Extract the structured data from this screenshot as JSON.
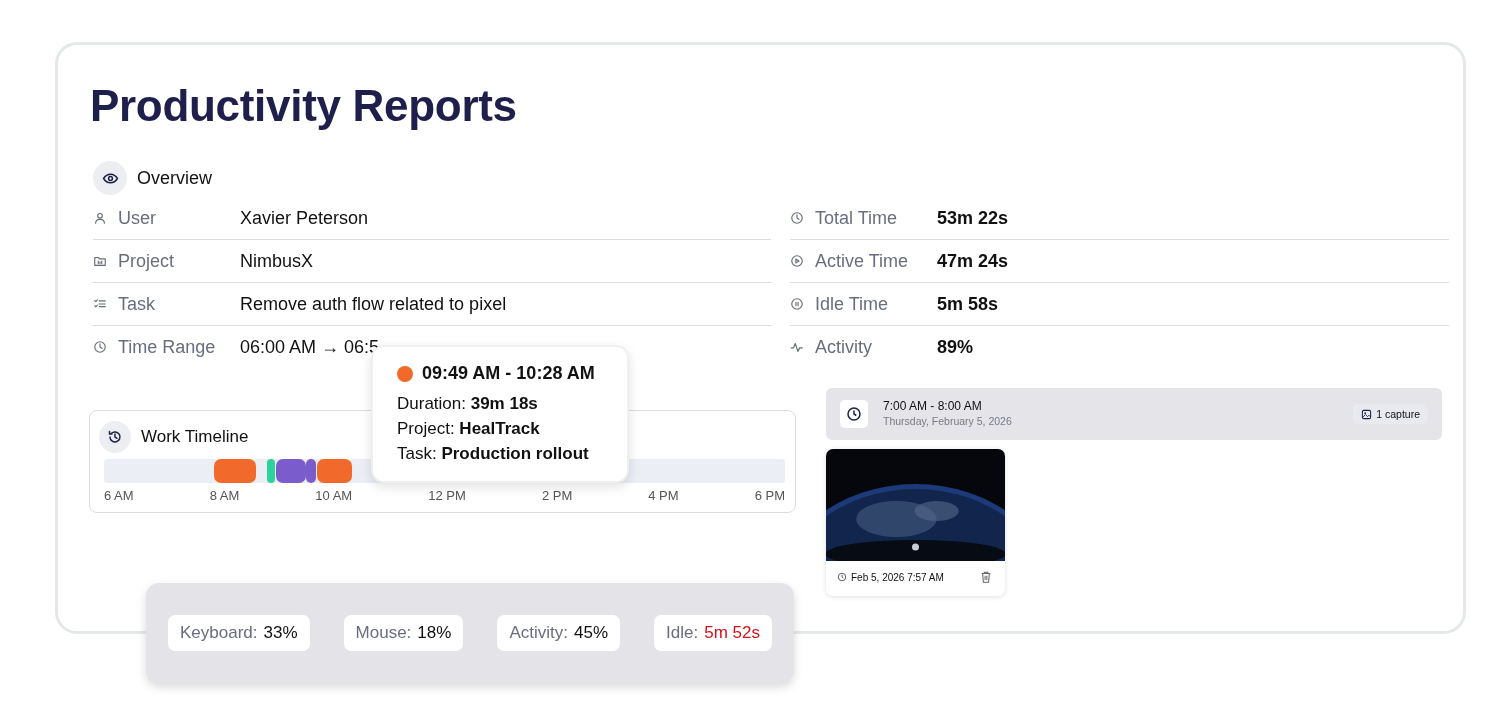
{
  "page": {
    "title": "Productivity Reports"
  },
  "overview": {
    "title": "Overview"
  },
  "details_left": [
    {
      "label": "User",
      "value": "Xavier Peterson"
    },
    {
      "label": "Project",
      "value": "NimbusX"
    },
    {
      "label": "Task",
      "value": "Remove auth flow related to pixel"
    },
    {
      "label": "Time Range",
      "value": "06:00 AM → 06:5"
    }
  ],
  "details_right": [
    {
      "label": "Total Time",
      "value": "53m 22s"
    },
    {
      "label": "Active Time",
      "value": "47m 24s"
    },
    {
      "label": "Idle Time",
      "value": "5m 58s"
    },
    {
      "label": "Activity",
      "value": "89%"
    }
  ],
  "timeline": {
    "title": "Work Timeline",
    "ticks": [
      "6 AM",
      "8 AM",
      "10 AM",
      "12 PM",
      "2 PM",
      "4 PM",
      "6 PM"
    ],
    "segments": [
      {
        "color": "#f26a2b"
      },
      {
        "color": "#2bd49a"
      },
      {
        "color": "#7a5ccc"
      },
      {
        "color": "#7a5ccc"
      },
      {
        "color": "#f26a2b"
      }
    ]
  },
  "tooltip": {
    "color": "#f26a2b",
    "time_range": "09:49 AM - 10:28 AM",
    "lines": [
      "Duration: **39m 18s**",
      "Project: **HealTrack**",
      "Task: **Production rollout**"
    ]
  },
  "captures_panel": {
    "time": "7:00 AM - 8:00 AM",
    "date": "Thursday, February 5, 2026",
    "count": "1 capture",
    "captures": [
      {
        "kind": "picture",
        "timestamp": "Feb 5, 2026 7:57 AM"
      }
    ]
  },
  "activity_stats": [
    {
      "label": "Keyboard:",
      "value": "33%",
      "alert": false
    },
    {
      "label": "Mouse:",
      "value": "18%",
      "alert": false
    },
    {
      "label": "Activity:",
      "value": "45%",
      "alert": false
    },
    {
      "label": "Idle:",
      "value": "5m 52s",
      "alert": true
    }
  ]
}
